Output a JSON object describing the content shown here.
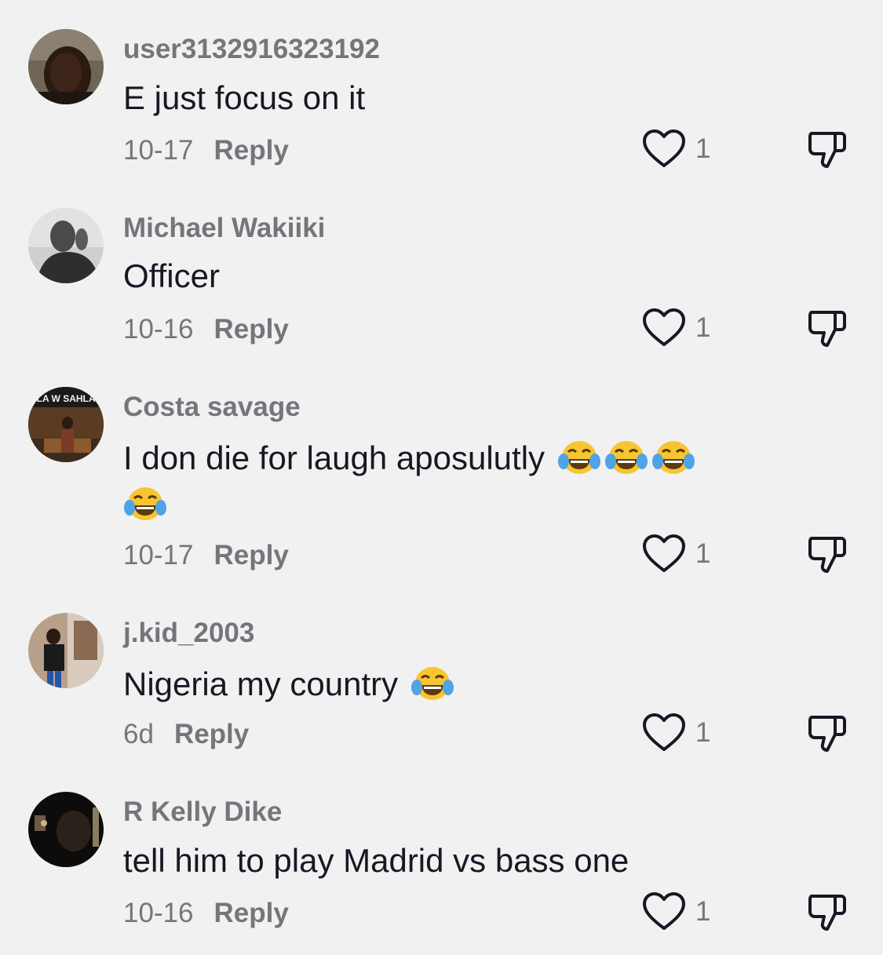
{
  "comments": [
    {
      "username": "user3132916323192",
      "text": "E just focus on it",
      "emoji_count": 0,
      "date": "10-17",
      "reply_label": "Reply",
      "likes": "1"
    },
    {
      "username": "Michael Wakiiki",
      "text": "Officer",
      "emoji_count": 0,
      "date": "10-16",
      "reply_label": "Reply",
      "likes": "1"
    },
    {
      "username": "Costa savage",
      "text": "I don die for laugh aposulutly",
      "emoji_count": 4,
      "emoji_name": "face-with-tears-of-joy-icon",
      "avatar_sign_text": "HLA W SAHLA",
      "date": "10-17",
      "reply_label": "Reply",
      "likes": "1"
    },
    {
      "username": "j.kid_2003",
      "text": "Nigeria my country",
      "emoji_count": 1,
      "emoji_name": "face-with-tears-of-joy-icon",
      "date": "6d",
      "reply_label": "Reply",
      "likes": "1"
    },
    {
      "username": "R Kelly Dike",
      "text": "tell him to play Madrid vs bass one",
      "emoji_count": 0,
      "date": "10-16",
      "reply_label": "Reply",
      "likes": "1"
    }
  ],
  "icons": {
    "like": "heart-outline-icon",
    "dislike": "thumbs-down-outline-icon"
  },
  "colors": {
    "background": "#f1f1f1",
    "text_primary": "#161823",
    "text_secondary": "#75767b",
    "icon": "#161823"
  }
}
